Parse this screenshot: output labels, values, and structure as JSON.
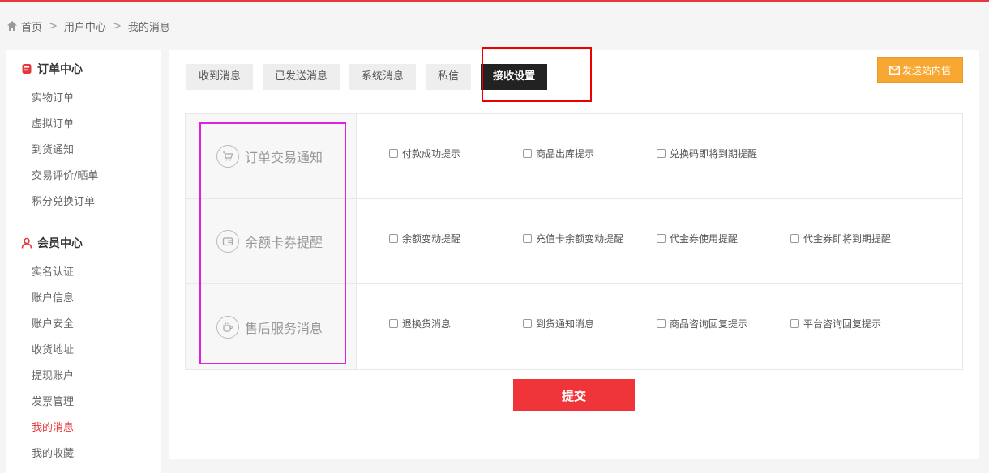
{
  "breadcrumb": {
    "home": "首页",
    "sep": ">",
    "user_center": "用户中心",
    "current": "我的消息"
  },
  "sidebar": {
    "order_center": {
      "title": "订单中心",
      "items": [
        {
          "label": "实物订单",
          "active": true
        },
        {
          "label": "虚拟订单",
          "active": false
        },
        {
          "label": "到货通知",
          "active": false
        },
        {
          "label": "交易评价/晒单",
          "active": false
        },
        {
          "label": "积分兑换订单",
          "active": false
        }
      ]
    },
    "member_center": {
      "title": "会员中心",
      "items": [
        {
          "label": "实名认证",
          "active": false
        },
        {
          "label": "账户信息",
          "active": false
        },
        {
          "label": "账户安全",
          "active": false
        },
        {
          "label": "收货地址",
          "active": false
        },
        {
          "label": "提现账户",
          "active": false
        },
        {
          "label": "发票管理",
          "active": false
        },
        {
          "label": "我的消息",
          "active": true
        },
        {
          "label": "我的收藏",
          "active": false
        }
      ]
    }
  },
  "tabs": [
    {
      "label": "收到消息",
      "active": false
    },
    {
      "label": "已发送消息",
      "active": false
    },
    {
      "label": "系统消息",
      "active": false
    },
    {
      "label": "私信",
      "active": false
    },
    {
      "label": "接收设置",
      "active": true
    }
  ],
  "send_button": {
    "label": "发送站内信"
  },
  "settings": [
    {
      "category": "订单交易通知",
      "icon": "cart-icon",
      "options": [
        "付款成功提示",
        "商品出库提示",
        "兑换码即将到期提醒"
      ]
    },
    {
      "category": "余额卡券提醒",
      "icon": "wallet-icon",
      "options": [
        "余额变动提醒",
        "充值卡余额变动提醒",
        "代金券使用提醒",
        "代金券即将到期提醒"
      ]
    },
    {
      "category": "售后服务消息",
      "icon": "coffee-cup-icon",
      "options": [
        "退换货消息",
        "到货通知消息",
        "商品咨询回复提示",
        "平台咨询回复提示"
      ]
    }
  ],
  "submit": {
    "label": "提交"
  },
  "colors": {
    "accent": "#e4393c",
    "submit": "#f0353a",
    "send_button": "#f8a832",
    "active_tab": "#222222",
    "highlight_red": "#ee0000",
    "highlight_magenta": "#e020e0"
  }
}
